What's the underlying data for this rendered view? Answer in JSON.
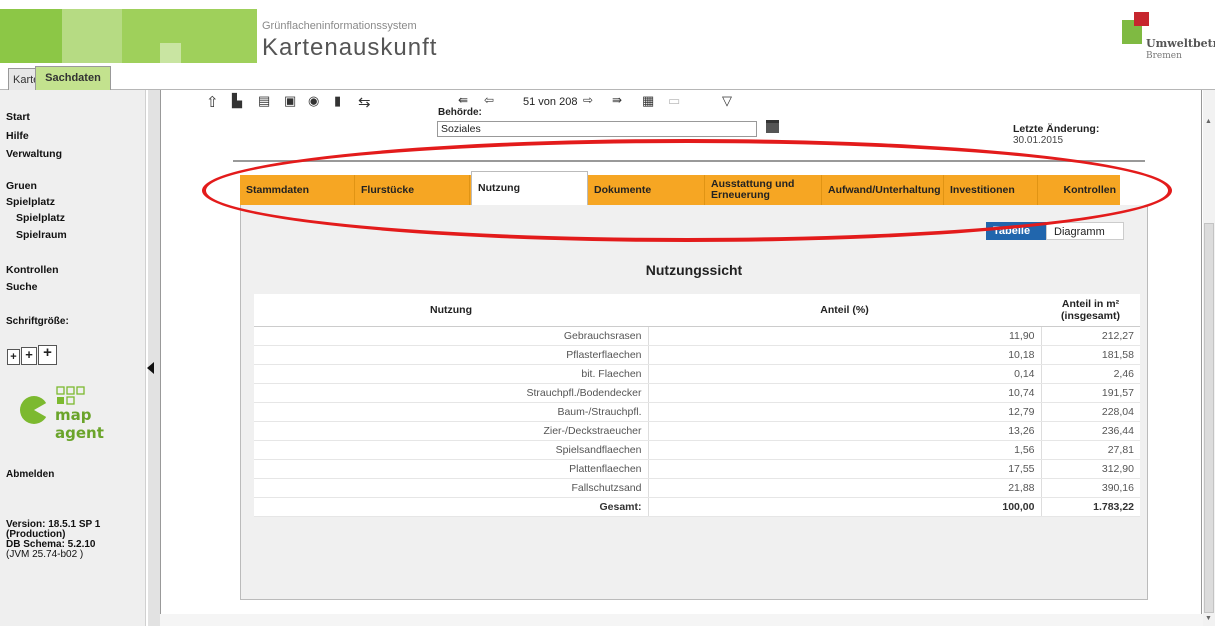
{
  "header": {
    "subtitle": "Grünflacheninformationssystem",
    "title": "Kartenauskunft",
    "logo_line1": "Umweltbetrie",
    "logo_line2": "Bremen"
  },
  "top_tabs": [
    {
      "label": "Karte"
    },
    {
      "label": "Sachdaten"
    }
  ],
  "sidebar": {
    "start": "Start",
    "hilfe": "Hilfe",
    "verwaltung": "Verwaltung",
    "gruen": "Gruen",
    "spielplatz": "Spielplatz",
    "spielplatz_sub": "Spielplatz",
    "spielraum_sub": "Spielraum",
    "kontrollen": "Kontrollen",
    "suche": "Suche",
    "schriftgroesse": "Schriftgröße:",
    "font_btn": "+",
    "mapagent": "map agent",
    "abmelden": "Abmelden",
    "version1": "Version: 18.5.1 SP 1",
    "version2": "(Production)",
    "version3": "DB Schema: 5.2.10",
    "version4": "(JVM 25.74-b02 )"
  },
  "toolbar": {
    "nav_text": "51 von 208",
    "behoerde_label": "Behörde:",
    "behoerde_value": "Soziales",
    "last_change_label": "Letzte Änderung:",
    "last_change_value": "30.01.2015"
  },
  "tabs": [
    {
      "label": "Stammdaten"
    },
    {
      "label": "Flurstücke"
    },
    {
      "label": "Nutzung"
    },
    {
      "label": "Dokumente"
    },
    {
      "label": "Ausstattung und Erneuerung"
    },
    {
      "label": "Aufwand/Unterhaltung"
    },
    {
      "label": "Investitionen"
    },
    {
      "label": "Kontrollen"
    }
  ],
  "view_toggle": {
    "table": "Tabelle",
    "diagram": "Diagramm"
  },
  "panel_title": "Nutzungssicht",
  "table": {
    "headers": [
      "Nutzung",
      "Anteil (%)",
      "Anteil in m²",
      "(insgesamt)"
    ],
    "rows": [
      {
        "name": "Gebrauchsrasen",
        "pct": "11,90",
        "m2": "212,27"
      },
      {
        "name": "Pflasterflaechen",
        "pct": "10,18",
        "m2": "181,58"
      },
      {
        "name": "bit. Flaechen",
        "pct": "0,14",
        "m2": "2,46"
      },
      {
        "name": "Strauchpfl./Bodendecker",
        "pct": "10,74",
        "m2": "191,57"
      },
      {
        "name": "Baum-/Strauchpfl.",
        "pct": "12,79",
        "m2": "228,04"
      },
      {
        "name": "Zier-/Deckstraeucher",
        "pct": "13,26",
        "m2": "236,44"
      },
      {
        "name": "Spielsandflaechen",
        "pct": "1,56",
        "m2": "27,81"
      },
      {
        "name": "Plattenflaechen",
        "pct": "17,55",
        "m2": "312,90"
      },
      {
        "name": "Fallschutzsand",
        "pct": "21,88",
        "m2": "390,16"
      }
    ],
    "total": {
      "name": "Gesamt:",
      "pct": "100,00",
      "m2": "1.783,22"
    }
  }
}
